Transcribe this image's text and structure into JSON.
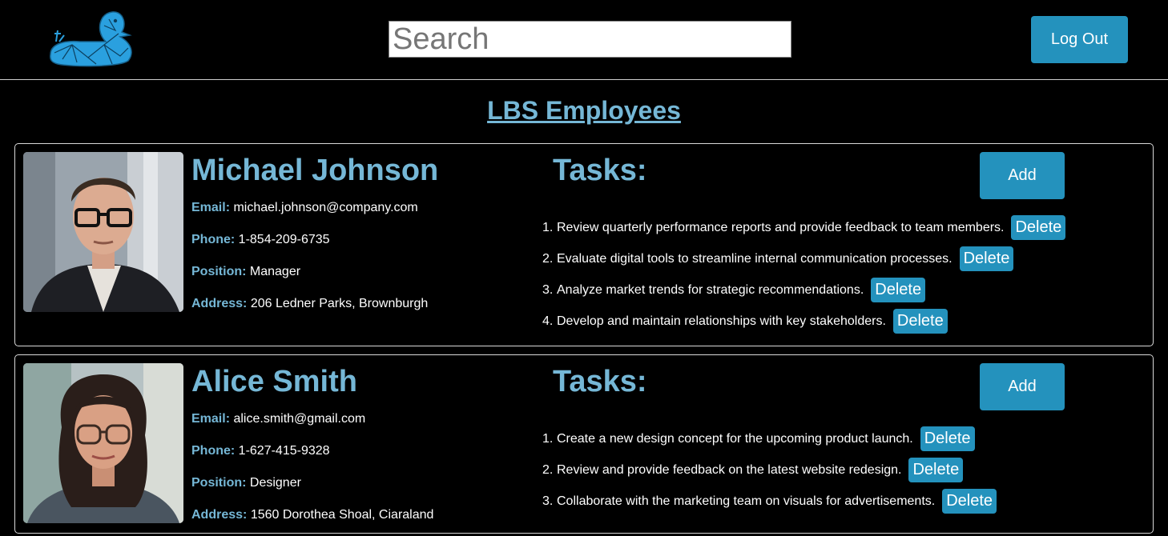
{
  "header": {
    "logo_icon": "duck-logo-icon",
    "search_placeholder": "Search",
    "logout_label": "Log Out"
  },
  "page_title": "LBS Employees",
  "colors": {
    "accent": "#2492bd",
    "label": "#75b7d6",
    "background": "#000000"
  },
  "labels": {
    "email": "Email:",
    "phone": "Phone:",
    "position": "Position:",
    "address": "Address:",
    "tasks_heading": "Tasks:",
    "add": "Add",
    "delete": "Delete"
  },
  "employees": [
    {
      "name": "Michael Johnson",
      "email": "michael.johnson@company.com",
      "phone": "1-854-209-6735",
      "position": "Manager",
      "address": "206 Ledner Parks, Brownburgh",
      "tasks": [
        "Review quarterly performance reports and provide feedback to team members.",
        "Evaluate digital tools to streamline internal communication processes.",
        "Analyze market trends for strategic recommendations.",
        "Develop and maintain relationships with key stakeholders."
      ]
    },
    {
      "name": "Alice Smith",
      "email": "alice.smith@gmail.com",
      "phone": "1-627-415-9328",
      "position": "Designer",
      "address": "1560 Dorothea Shoal, Ciaraland",
      "tasks": [
        "Create a new design concept for the upcoming product launch.",
        "Review and provide feedback on the latest website redesign.",
        "Collaborate with the marketing team on visuals for advertisements."
      ]
    }
  ]
}
